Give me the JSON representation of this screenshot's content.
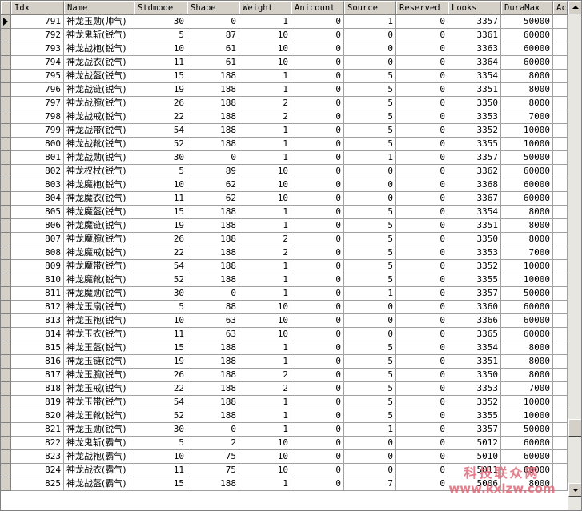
{
  "columns": [
    "Idx",
    "Name",
    "Stdmode",
    "Shape",
    "Weight",
    "Anicount",
    "Source",
    "Reserved",
    "Looks",
    "DuraMax",
    "Ac"
  ],
  "rows": [
    [
      "791",
      "神龙玉勋(帅气)",
      "30",
      "0",
      "1",
      "0",
      "1",
      "0",
      "3357",
      "50000"
    ],
    [
      "792",
      "神龙鬼斩(锐气)",
      "5",
      "87",
      "10",
      "0",
      "0",
      "0",
      "3361",
      "60000"
    ],
    [
      "793",
      "神龙战袍(锐气)",
      "10",
      "61",
      "10",
      "0",
      "0",
      "0",
      "3363",
      "60000"
    ],
    [
      "794",
      "神龙战衣(锐气)",
      "11",
      "61",
      "10",
      "0",
      "0",
      "0",
      "3364",
      "60000"
    ],
    [
      "795",
      "神龙战盔(锐气)",
      "15",
      "188",
      "1",
      "0",
      "5",
      "0",
      "3354",
      "8000"
    ],
    [
      "796",
      "神龙战链(锐气)",
      "19",
      "188",
      "1",
      "0",
      "5",
      "0",
      "3351",
      "8000"
    ],
    [
      "797",
      "神龙战腕(锐气)",
      "26",
      "188",
      "2",
      "0",
      "5",
      "0",
      "3350",
      "8000"
    ],
    [
      "798",
      "神龙战戒(锐气)",
      "22",
      "188",
      "2",
      "0",
      "5",
      "0",
      "3353",
      "7000"
    ],
    [
      "799",
      "神龙战带(锐气)",
      "54",
      "188",
      "1",
      "0",
      "5",
      "0",
      "3352",
      "10000"
    ],
    [
      "800",
      "神龙战靴(锐气)",
      "52",
      "188",
      "1",
      "0",
      "5",
      "0",
      "3355",
      "10000"
    ],
    [
      "801",
      "神龙战勋(锐气)",
      "30",
      "0",
      "1",
      "0",
      "1",
      "0",
      "3357",
      "50000"
    ],
    [
      "802",
      "神龙权杖(锐气)",
      "5",
      "89",
      "10",
      "0",
      "0",
      "0",
      "3362",
      "60000"
    ],
    [
      "803",
      "神龙魔袍(锐气)",
      "10",
      "62",
      "10",
      "0",
      "0",
      "0",
      "3368",
      "60000"
    ],
    [
      "804",
      "神龙魔衣(锐气)",
      "11",
      "62",
      "10",
      "0",
      "0",
      "0",
      "3367",
      "60000"
    ],
    [
      "805",
      "神龙魔盔(锐气)",
      "15",
      "188",
      "1",
      "0",
      "5",
      "0",
      "3354",
      "8000"
    ],
    [
      "806",
      "神龙魔链(锐气)",
      "19",
      "188",
      "1",
      "0",
      "5",
      "0",
      "3351",
      "8000"
    ],
    [
      "807",
      "神龙魔腕(锐气)",
      "26",
      "188",
      "2",
      "0",
      "5",
      "0",
      "3350",
      "8000"
    ],
    [
      "808",
      "神龙魔戒(锐气)",
      "22",
      "188",
      "2",
      "0",
      "5",
      "0",
      "3353",
      "7000"
    ],
    [
      "809",
      "神龙魔带(锐气)",
      "54",
      "188",
      "1",
      "0",
      "5",
      "0",
      "3352",
      "10000"
    ],
    [
      "810",
      "神龙魔靴(锐气)",
      "52",
      "188",
      "1",
      "0",
      "5",
      "0",
      "3355",
      "10000"
    ],
    [
      "811",
      "神龙魔勋(锐气)",
      "30",
      "0",
      "1",
      "0",
      "1",
      "0",
      "3357",
      "50000"
    ],
    [
      "812",
      "神龙玉扇(锐气)",
      "5",
      "88",
      "10",
      "0",
      "0",
      "0",
      "3360",
      "60000"
    ],
    [
      "813",
      "神龙玉袍(锐气)",
      "10",
      "63",
      "10",
      "0",
      "0",
      "0",
      "3366",
      "60000"
    ],
    [
      "814",
      "神龙玉衣(锐气)",
      "11",
      "63",
      "10",
      "0",
      "0",
      "0",
      "3365",
      "60000"
    ],
    [
      "815",
      "神龙玉盔(锐气)",
      "15",
      "188",
      "1",
      "0",
      "5",
      "0",
      "3354",
      "8000"
    ],
    [
      "816",
      "神龙玉链(锐气)",
      "19",
      "188",
      "1",
      "0",
      "5",
      "0",
      "3351",
      "8000"
    ],
    [
      "817",
      "神龙玉腕(锐气)",
      "26",
      "188",
      "2",
      "0",
      "5",
      "0",
      "3350",
      "8000"
    ],
    [
      "818",
      "神龙玉戒(锐气)",
      "22",
      "188",
      "2",
      "0",
      "5",
      "0",
      "3353",
      "7000"
    ],
    [
      "819",
      "神龙玉带(锐气)",
      "54",
      "188",
      "1",
      "0",
      "5",
      "0",
      "3352",
      "10000"
    ],
    [
      "820",
      "神龙玉靴(锐气)",
      "52",
      "188",
      "1",
      "0",
      "5",
      "0",
      "3355",
      "10000"
    ],
    [
      "821",
      "神龙玉勋(锐气)",
      "30",
      "0",
      "1",
      "0",
      "1",
      "0",
      "3357",
      "50000"
    ],
    [
      "822",
      "神龙鬼斩(霸气)",
      "5",
      "2",
      "10",
      "0",
      "0",
      "0",
      "5012",
      "60000"
    ],
    [
      "823",
      "神龙战袍(霸气)",
      "10",
      "75",
      "10",
      "0",
      "0",
      "0",
      "5010",
      "60000"
    ],
    [
      "824",
      "神龙战衣(霸气)",
      "11",
      "75",
      "10",
      "0",
      "0",
      "0",
      "5011",
      "60000"
    ],
    [
      "825",
      "神龙战盔(霸气)",
      "15",
      "188",
      "1",
      "0",
      "7",
      "0",
      "5006",
      "8000"
    ]
  ],
  "watermark": {
    "text_cn": "科技联众网",
    "url": "www.kxlzw.com"
  },
  "colors": {
    "grid_bg": "#ffffff",
    "chrome": "#d4d0c8",
    "watermark": "#e06a7a"
  }
}
